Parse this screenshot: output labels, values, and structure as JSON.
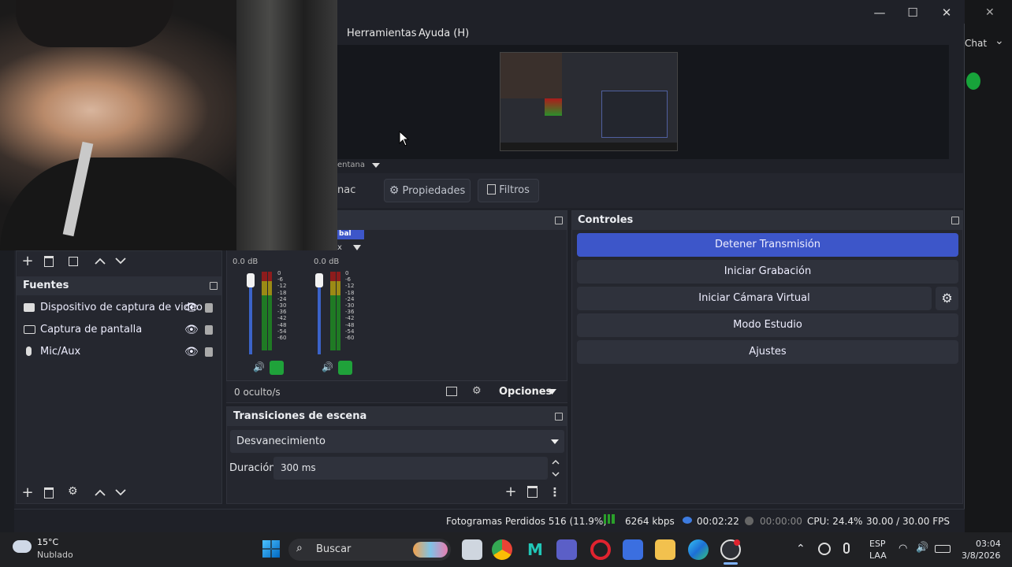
{
  "menu": {
    "herramientas": "Herramientas",
    "ayuda": "Ayuda (H)"
  },
  "window": {
    "minimize": "—",
    "maximize": "☐",
    "close": "✕"
  },
  "right_peek": {
    "chat": "Chat",
    "close": "✕",
    "chevron": "⌄"
  },
  "scene_source_selector": "entana",
  "tabs": {
    "partial": "nac",
    "properties": "Propiedades",
    "filters": "Filtros"
  },
  "sources": {
    "title": "Fuentes",
    "items": [
      {
        "label": "Dispositivo de captura de video",
        "icon": "camera-icon"
      },
      {
        "label": "Captura de pantalla",
        "icon": "monitor-icon"
      },
      {
        "label": "Mic/Aux",
        "icon": "mic-icon"
      }
    ]
  },
  "mixer": {
    "channels": [
      {
        "db": "0.0 dB",
        "volume": 0.95,
        "label": "bal"
      },
      {
        "db": "0.0 dB",
        "volume": 0.95,
        "label": "x"
      }
    ],
    "scale": [
      "0",
      "-6",
      "-12",
      "-18",
      "-24",
      "-30",
      "-36",
      "-42",
      "-48",
      "-54",
      "-60"
    ],
    "hidden": "0 oculto/s",
    "options": "Opciones"
  },
  "transitions": {
    "title": "Transiciones de escena",
    "selected": "Desvanecimiento",
    "duration_label": "Duración",
    "duration_value": "300 ms"
  },
  "controls": {
    "title": "Controles",
    "stop_stream": "Detener Transmisión",
    "start_recording": "Iniciar Grabación",
    "start_virtual_cam": "Iniciar Cámara Virtual",
    "studio_mode": "Modo Estudio",
    "settings": "Ajustes"
  },
  "status": {
    "dropped": "Fotogramas Perdidos 516 (11.9%)",
    "bitrate": "6264 kbps",
    "stream_time": "00:02:22",
    "rec_time": "00:00:00",
    "cpu": "CPU: 24.4%",
    "fps": "30.00 / 30.00 FPS"
  },
  "taskbar": {
    "weather_temp": "15°C",
    "weather_desc": "Nublado",
    "search": "Buscar",
    "lang": "ESP",
    "layout": "LAA",
    "time": "03:04",
    "date": "3/8/2026"
  },
  "colors": {
    "accent": "#3d56c9",
    "active_green": "#1fa23a"
  }
}
